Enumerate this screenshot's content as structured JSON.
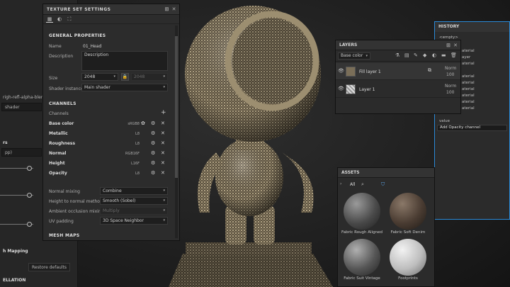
{
  "left_panel": {
    "row1": "righ-refl-alpha-blende",
    "row2": "shader",
    "row3": "rs",
    "row4": "pp)",
    "mapping": "h Mapping",
    "restore_defaults": "Restore defaults",
    "tessellation": "ELLATION"
  },
  "texture_set_settings": {
    "title": "TEXTURE SET SETTINGS",
    "general_properties": "GENERAL PROPERTIES",
    "name_label": "Name",
    "name_value": "01_Head",
    "description_label": "Description",
    "description_value": "Description",
    "size_label": "Size",
    "size_value": "2048",
    "size_linked_value": "2048",
    "shader_instance_label": "Shader instance",
    "shader_instance_value": "Main shader",
    "channels_header": "CHANNELS",
    "channels_label": "Channels",
    "add_icon": "+",
    "channels": [
      {
        "name": "Base color",
        "format": "sRGB8"
      },
      {
        "name": "Metallic",
        "format": "L8"
      },
      {
        "name": "Roughness",
        "format": "L8"
      },
      {
        "name": "Normal",
        "format": "RGB16F"
      },
      {
        "name": "Height",
        "format": "L16F"
      },
      {
        "name": "Opacity",
        "format": "L8"
      }
    ],
    "normal_mixing_label": "Normal mixing",
    "normal_mixing_value": "Combine",
    "height_to_normal_label": "Height to normal method",
    "height_to_normal_value": "Smooth (Sobel)",
    "ao_mixing_label": "Ambient occlusion mixing",
    "ao_mixing_value": "Multiply",
    "uv_padding_label": "UV padding",
    "uv_padding_value": "3D Space Neighbor",
    "mesh_maps_header": "MESH MAPS"
  },
  "layers": {
    "title": "LAYERS",
    "channel_select": "Base color",
    "items": [
      {
        "name": "Fill layer 1",
        "blend": "Norm",
        "opacity": "100"
      },
      {
        "name": "Layer 1",
        "blend": "Norm",
        "opacity": "100"
      }
    ]
  },
  "history": {
    "title": "HISTORY",
    "first": "<empty>",
    "items": [
      "aterial",
      "ayer",
      "aterial",
      "aterial",
      "aterial",
      "aterial",
      "aterial",
      "aterial",
      "aterial"
    ],
    "value_item": "value",
    "selected": "Add Opacity channel"
  },
  "assets": {
    "title": "ASSETS",
    "filter": "All",
    "items": [
      {
        "label": "Fabric Rough Aligned"
      },
      {
        "label": "Fabric Soft Denim"
      },
      {
        "label": "Fabric Suit Vintage"
      },
      {
        "label": "Footprints"
      }
    ]
  },
  "colors": {
    "accent": "#2a8ad8",
    "panel": "#2c2c2c",
    "viewport": "#202020"
  }
}
